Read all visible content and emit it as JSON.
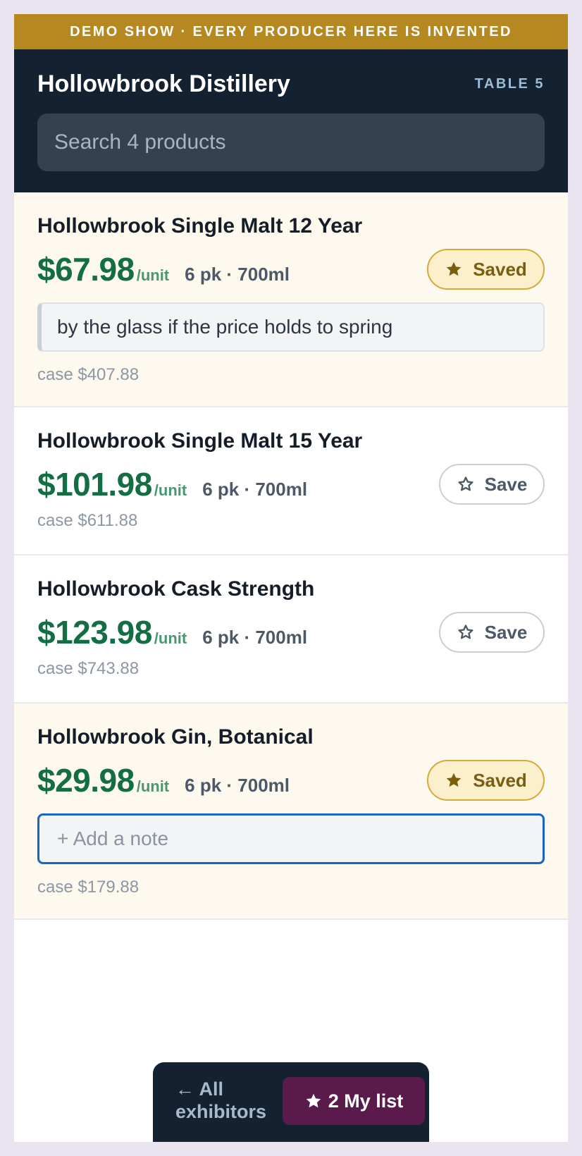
{
  "banner": {
    "text": "DEMO SHOW · EVERY PRODUCER HERE IS INVENTED"
  },
  "header": {
    "exhibitor": "Hollowbrook Distillery",
    "table": "TABLE 5",
    "search_placeholder": "Search 4 products"
  },
  "products": [
    {
      "name": "Hollowbrook Single Malt 12 Year",
      "price": "$67.98",
      "unit": "/unit",
      "pack": "6 pk · 700ml",
      "saved": true,
      "save_label": "Saved",
      "note": "by the glass if the price holds to spring",
      "case": "case $407.88"
    },
    {
      "name": "Hollowbrook Single Malt 15 Year",
      "price": "$101.98",
      "unit": "/unit",
      "pack": "6 pk · 700ml",
      "saved": false,
      "save_label": "Save",
      "case": "case $611.88"
    },
    {
      "name": "Hollowbrook Cask Strength",
      "price": "$123.98",
      "unit": "/unit",
      "pack": "6 pk · 700ml",
      "saved": false,
      "save_label": "Save",
      "case": "case $743.88"
    },
    {
      "name": "Hollowbrook Gin, Botanical",
      "price": "$29.98",
      "unit": "/unit",
      "pack": "6 pk · 700ml",
      "saved": true,
      "save_label": "Saved",
      "note_placeholder": "+ Add a note",
      "case": "case $179.88"
    }
  ],
  "bottom_bar": {
    "back_label": "← All exhibitors",
    "mylist_label": "2 My list"
  },
  "colors": {
    "banner": "#b5891f",
    "header": "#132131",
    "price": "#136e43",
    "saved_bg": "#fdf9ee",
    "mylist": "#5a1b4c",
    "focus": "#1c64c2"
  },
  "icons": {
    "saved": "star-filled-icon",
    "save": "star-outline-icon",
    "mylist": "star-filled-icon"
  }
}
